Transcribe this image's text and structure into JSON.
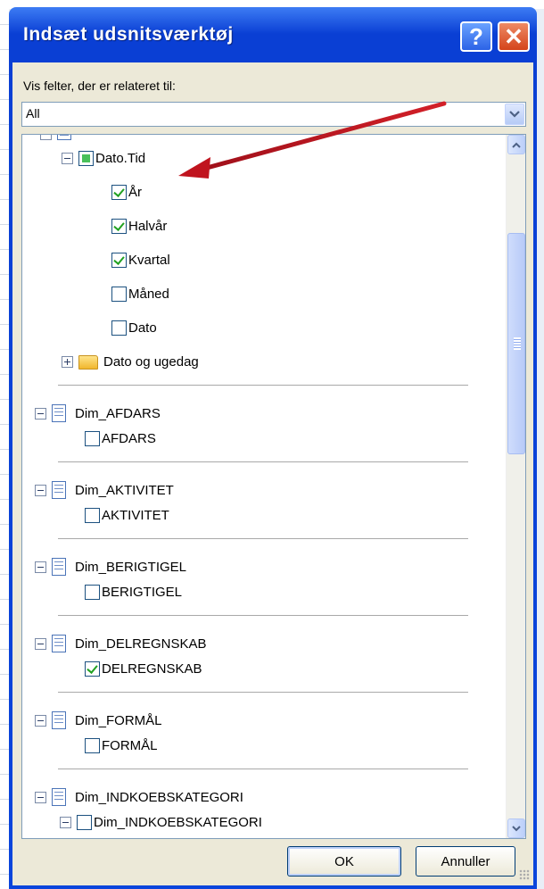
{
  "window": {
    "title": "Indsæt udsnitsværktøj",
    "help_label": "?",
    "close_label": "✕"
  },
  "filter": {
    "label": "Vis felter, der er relateret til:",
    "value": "All"
  },
  "tree": {
    "dato_tid": {
      "label": "Dato.Tid",
      "children": [
        {
          "label": "År",
          "checked": true
        },
        {
          "label": "Halvår",
          "checked": true
        },
        {
          "label": "Kvartal",
          "checked": true
        },
        {
          "label": "Måned",
          "checked": false
        },
        {
          "label": "Dato",
          "checked": false
        }
      ]
    },
    "folder": {
      "label": "Dato og ugedag"
    },
    "dims": [
      {
        "label": "Dim_AFDARS",
        "child": "AFDARS",
        "checked": false
      },
      {
        "label": "Dim_AKTIVITET",
        "child": "AKTIVITET",
        "checked": false
      },
      {
        "label": "Dim_BERIGTIGEL",
        "child": "BERIGTIGEL",
        "checked": false
      },
      {
        "label": "Dim_DELREGNSKAB",
        "child": "DELREGNSKAB",
        "checked": true
      },
      {
        "label": "Dim_FORMÅL",
        "child": "FORMÅL",
        "checked": false
      },
      {
        "label": "Dim_INDKOEBSKATEGORI",
        "child": "Dim_INDKOEBSKATEGORI",
        "checked": false
      }
    ]
  },
  "buttons": {
    "ok": "OK",
    "cancel": "Annuller"
  },
  "colors": {
    "title_bar": "#0a45dc",
    "client_bg": "#ece9d8",
    "check_green": "#21a121",
    "annotation_arrow": "#c0141e"
  }
}
